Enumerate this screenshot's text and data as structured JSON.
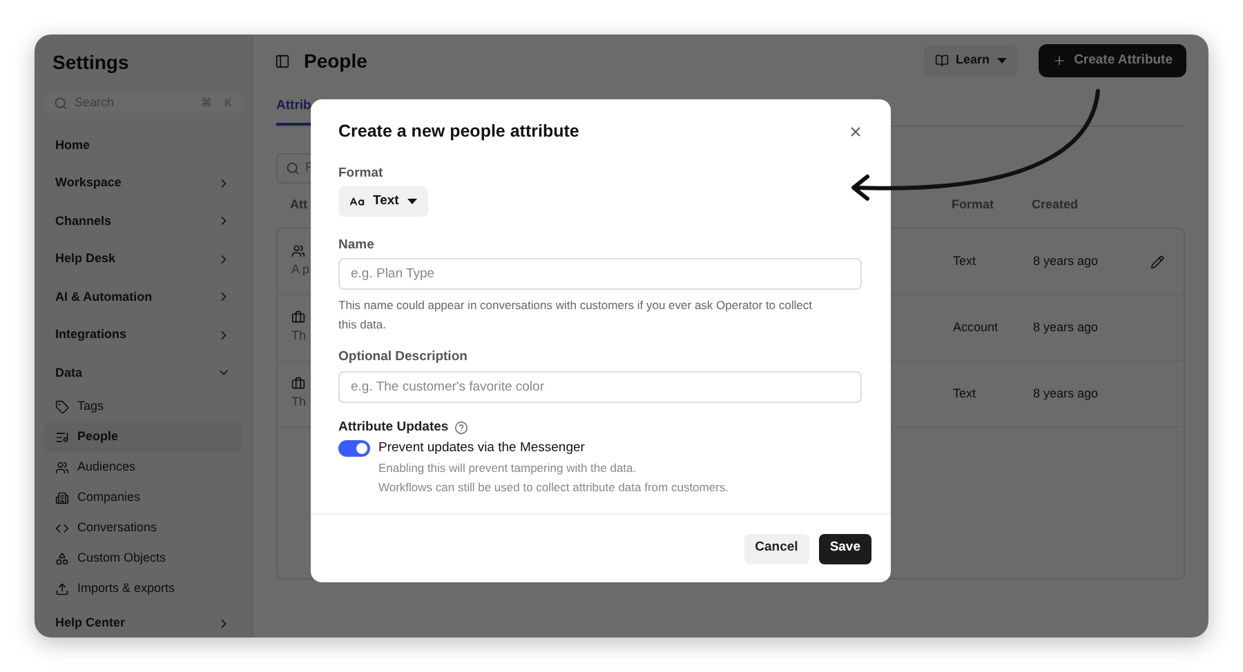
{
  "sidebar": {
    "title": "Settings",
    "search": {
      "placeholder": "Search",
      "shortcut": [
        "⌘",
        "K"
      ]
    },
    "items": [
      {
        "kind": "link",
        "label": "Home"
      },
      {
        "kind": "section",
        "label": "Workspace",
        "expanded": false
      },
      {
        "kind": "section",
        "label": "Channels",
        "expanded": false
      },
      {
        "kind": "section",
        "label": "Help Desk",
        "expanded": false
      },
      {
        "kind": "section",
        "label": "AI & Automation",
        "expanded": false
      },
      {
        "kind": "section",
        "label": "Integrations",
        "expanded": false
      },
      {
        "kind": "section",
        "label": "Data",
        "expanded": true,
        "children": [
          {
            "label": "Tags",
            "selected": false
          },
          {
            "label": "People",
            "selected": true
          },
          {
            "label": "Audiences",
            "selected": false
          },
          {
            "label": "Companies",
            "selected": false
          },
          {
            "label": "Conversations",
            "selected": false
          },
          {
            "label": "Custom Objects",
            "selected": false
          },
          {
            "label": "Imports & exports",
            "selected": false
          }
        ]
      },
      {
        "kind": "section",
        "label": "Help Center",
        "expanded": false
      }
    ]
  },
  "header": {
    "title": "People",
    "learn_button": "Learn",
    "create_button": "Create Attribute"
  },
  "tabs": [
    {
      "label": "Attrib",
      "selected": true
    }
  ],
  "filter": {
    "placeholder": "F"
  },
  "table": {
    "columns": [
      "Att",
      "Format",
      "Created"
    ],
    "rows": [
      {
        "description": "A p",
        "format": "Text",
        "created": "8 years ago",
        "editable": true
      },
      {
        "description": "Th",
        "format": "Account",
        "created": "8 years ago",
        "editable": false
      },
      {
        "description": "Th",
        "format": "Text",
        "created": "8 years ago",
        "editable": false
      }
    ]
  },
  "modal": {
    "title": "Create a new people attribute",
    "format": {
      "label": "Format",
      "value": "Text"
    },
    "name": {
      "label": "Name",
      "placeholder": "e.g. Plan Type",
      "help": "This name could appear in conversations with customers if you ever ask Operator to collect this data."
    },
    "description": {
      "label": "Optional Description",
      "placeholder": "e.g. The customer's favorite color"
    },
    "updates": {
      "label": "Attribute Updates",
      "toggle_label": "Prevent updates via the Messenger",
      "on": true,
      "help": [
        "Enabling this will prevent tampering with the data.",
        "Workflows can still be used to collect attribute data from customers."
      ]
    },
    "buttons": {
      "cancel": "Cancel",
      "save": "Save"
    }
  }
}
